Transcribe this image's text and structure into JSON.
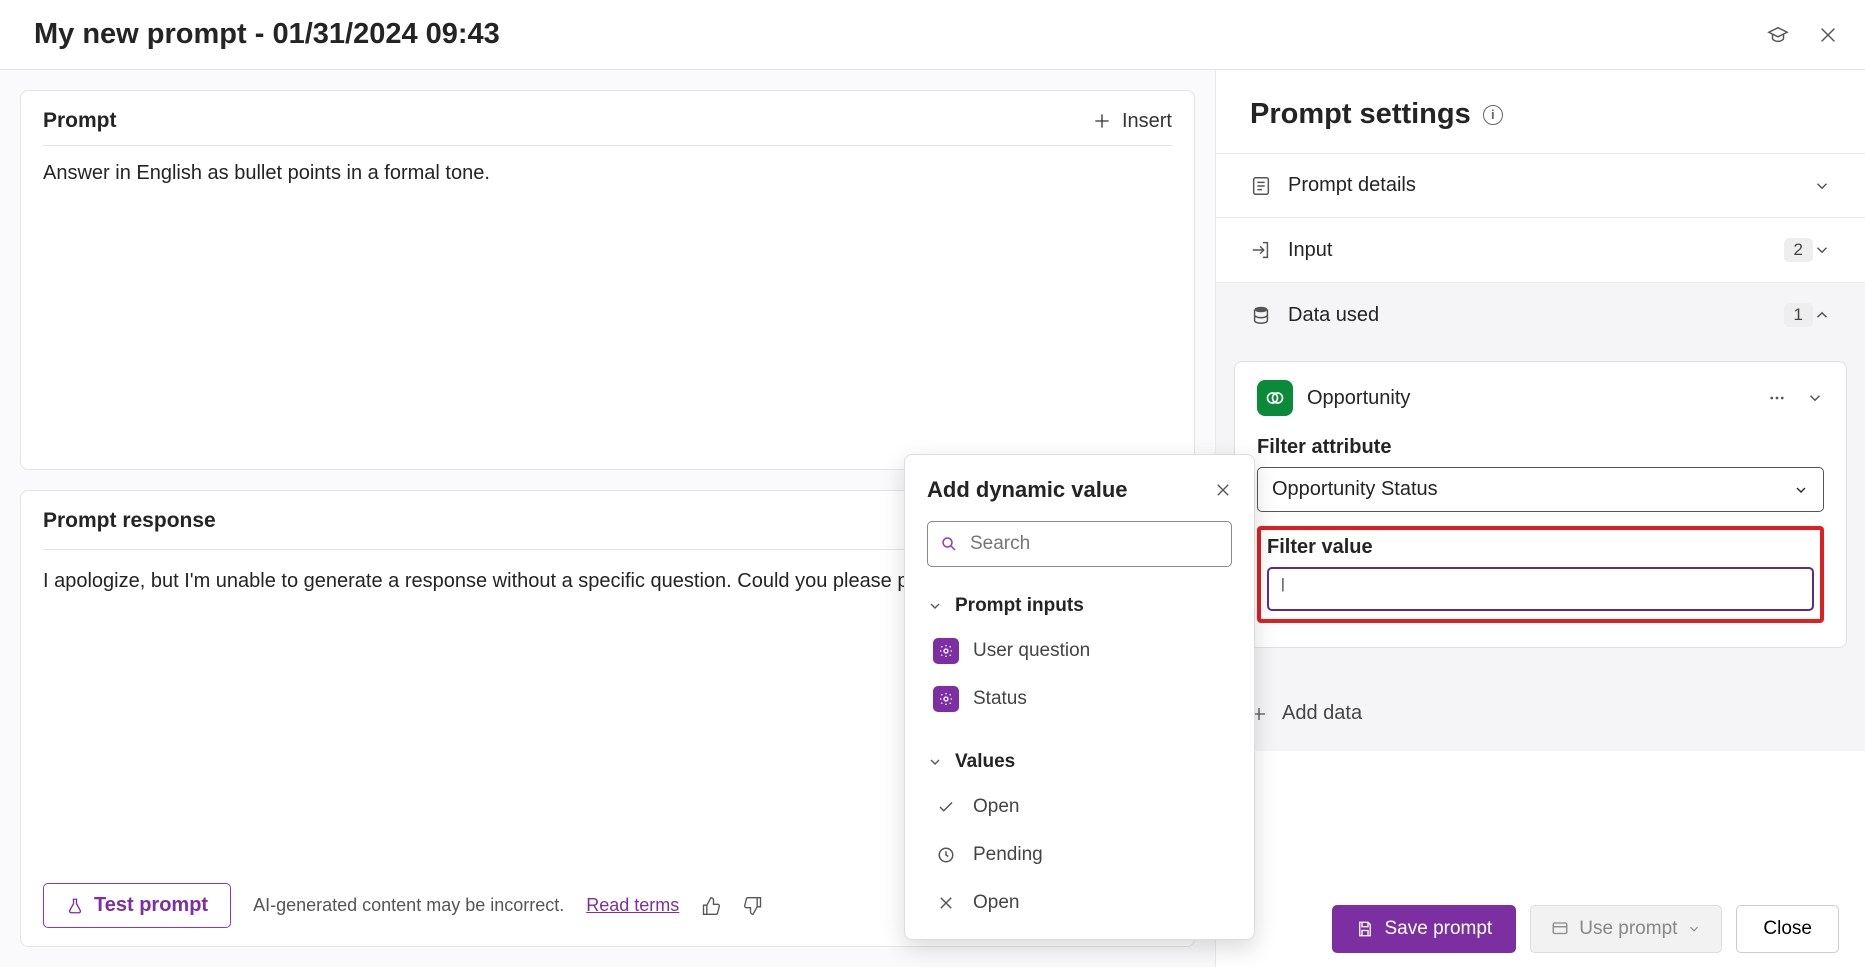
{
  "header": {
    "title": "My new prompt - 01/31/2024 09:43"
  },
  "prompt_card": {
    "heading": "Prompt",
    "insert_label": "Insert",
    "text": "Answer in English as bullet points in a formal tone."
  },
  "response_card": {
    "heading": "Prompt response",
    "body": "I apologize, but I'm unable to generate a response without a specific question. Could you please provide more de",
    "test_label": "Test prompt",
    "disclaimer": "AI-generated content may be incorrect.",
    "terms_label": "Read terms"
  },
  "settings": {
    "title": "Prompt settings",
    "sections": {
      "details": {
        "label": "Prompt details"
      },
      "input": {
        "label": "Input",
        "count": "2"
      },
      "data": {
        "label": "Data used",
        "count": "1"
      }
    },
    "data_used": {
      "entity_name": "Opportunity",
      "filter_attribute_label": "Filter attribute",
      "filter_attribute_value": "Opportunity Status",
      "filter_value_label": "Filter value",
      "filter_value": ""
    },
    "add_data_label": "Add data"
  },
  "footer": {
    "save_label": "Save prompt",
    "use_label": "Use prompt",
    "close_label": "Close"
  },
  "popover": {
    "title": "Add dynamic value",
    "search_placeholder": "Search",
    "sections": {
      "inputs": {
        "label": "Prompt inputs",
        "items": [
          "User question",
          "Status"
        ]
      },
      "values": {
        "label": "Values",
        "items": [
          {
            "icon": "check",
            "label": "Open"
          },
          {
            "icon": "clock",
            "label": "Pending"
          },
          {
            "icon": "x",
            "label": "Open"
          }
        ]
      }
    }
  }
}
